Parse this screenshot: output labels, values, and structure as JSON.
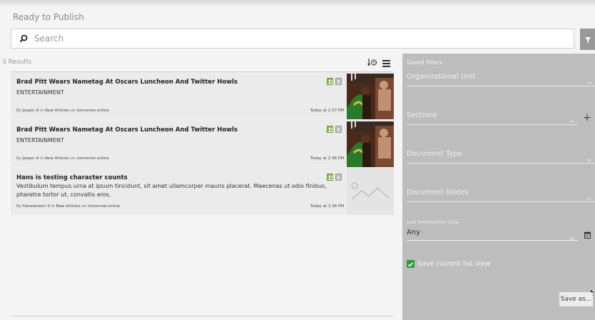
{
  "header": {
    "title": "Ready to Publish"
  },
  "search": {
    "placeholder": "Search",
    "value": ""
  },
  "results": {
    "count_label": "3 Results",
    "items": [
      {
        "title": "Brad Pitt Wears Nametag At Oscars Luncheon And Twitter Howls",
        "section": "ENTERTAINMENT",
        "byline_prefix": "By",
        "author": "Jesper A",
        "in_word": "in",
        "category": "New Articles",
        "on_word": "on",
        "site": "tomorrow-online",
        "date": "Today at 2:37 PM"
      },
      {
        "title": "Brad Pitt Wears Nametag At Oscars Luncheon And Twitter Howls",
        "section": "ENTERTAINMENT",
        "byline_prefix": "By",
        "author": "Jesper A",
        "in_word": "in",
        "category": "New Articles",
        "on_word": "on",
        "site": "tomorrow-online",
        "date": "Today at 2:36 PM"
      },
      {
        "title": "Hans is testing character counts",
        "description": "Vestibulum tempus urna at ipsum tincidunt, sit amet ullamcorper mauris placerat. Maecenas ut odio finibus, pharetra tortor ut, convallis eros.",
        "byline_prefix": "By",
        "author": "Hansemann S",
        "in_word": "in",
        "category": "New Articles",
        "on_word": "on",
        "site": "tomorrow-online",
        "date": "Today at 2:36 PM"
      }
    ]
  },
  "filters": {
    "saved_filters_label": "Saved filters",
    "organizational_unit": "Organizational Unit",
    "sections": "Sections",
    "document_type": "Document Type",
    "document_states": "Document States",
    "last_mod_label": "Last Modification Date",
    "last_mod_value": "Any",
    "save_view_label": "Save current list view",
    "save_view_checked": true,
    "save_as_label": "Save as..."
  },
  "colors": {
    "panel_bg": "#bdbdbd",
    "checkbox_green": "#2e9b2e",
    "filter_button": "#999999"
  },
  "icons": [
    "search-icon",
    "filter-icon",
    "sort-by-date-icon",
    "list-view-icon",
    "publish-status-icon",
    "document-icon",
    "image-placeholder-icon",
    "chevron-down-icon",
    "plus-icon",
    "calendar-icon",
    "check-icon",
    "mouse-cursor-icon"
  ]
}
